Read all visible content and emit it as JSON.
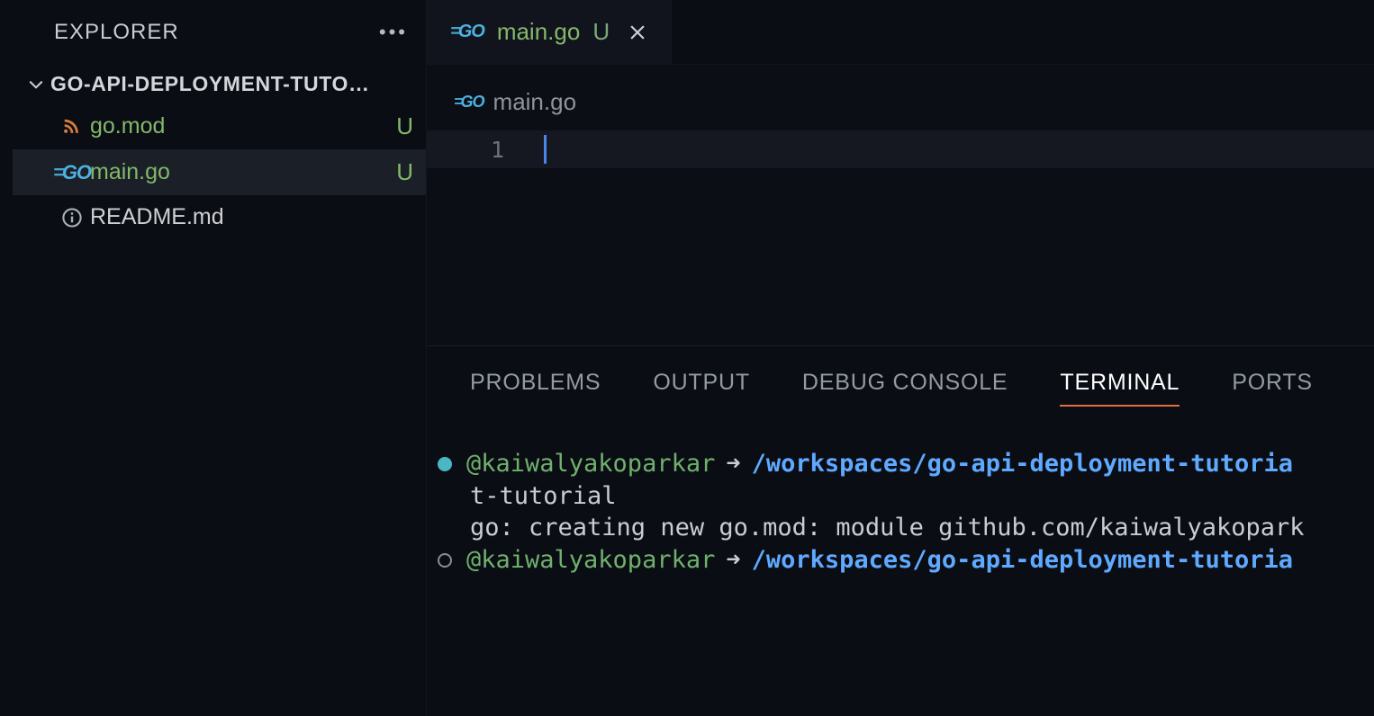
{
  "explorer": {
    "title": "EXPLORER",
    "folder_name": "GO-API-DEPLOYMENT-TUTO…",
    "files": [
      {
        "name": "go.mod",
        "status": "U",
        "icon": "rss",
        "color": "green"
      },
      {
        "name": "main.go",
        "status": "U",
        "icon": "go",
        "color": "green",
        "selected": true
      },
      {
        "name": "README.md",
        "status": "",
        "icon": "info",
        "color": "default"
      }
    ]
  },
  "editor": {
    "tab": {
      "file": "main.go",
      "status": "U",
      "icon": "go"
    },
    "breadcrumb": {
      "file": "main.go",
      "icon": "go"
    },
    "line_number": "1"
  },
  "panel": {
    "tabs": [
      "PROBLEMS",
      "OUTPUT",
      "DEBUG CONSOLE",
      "TERMINAL",
      "PORTS"
    ],
    "active_tab_index": 3,
    "terminal": {
      "lines": [
        {
          "bullet": "filled",
          "user": "@kaiwalyakoparkar",
          "arrow": "➜",
          "path": "/workspaces/go-api-deployment-tutoria"
        },
        {
          "plain": "t-tutorial"
        },
        {
          "plain": "go: creating new go.mod: module github.com/kaiwalyakopark"
        },
        {
          "bullet": "hollow",
          "user": "@kaiwalyakoparkar",
          "arrow": "➜",
          "path": "/workspaces/go-api-deployment-tutoria"
        }
      ]
    }
  },
  "icons": {
    "go_eq": "=",
    "go_txt": "GO"
  }
}
